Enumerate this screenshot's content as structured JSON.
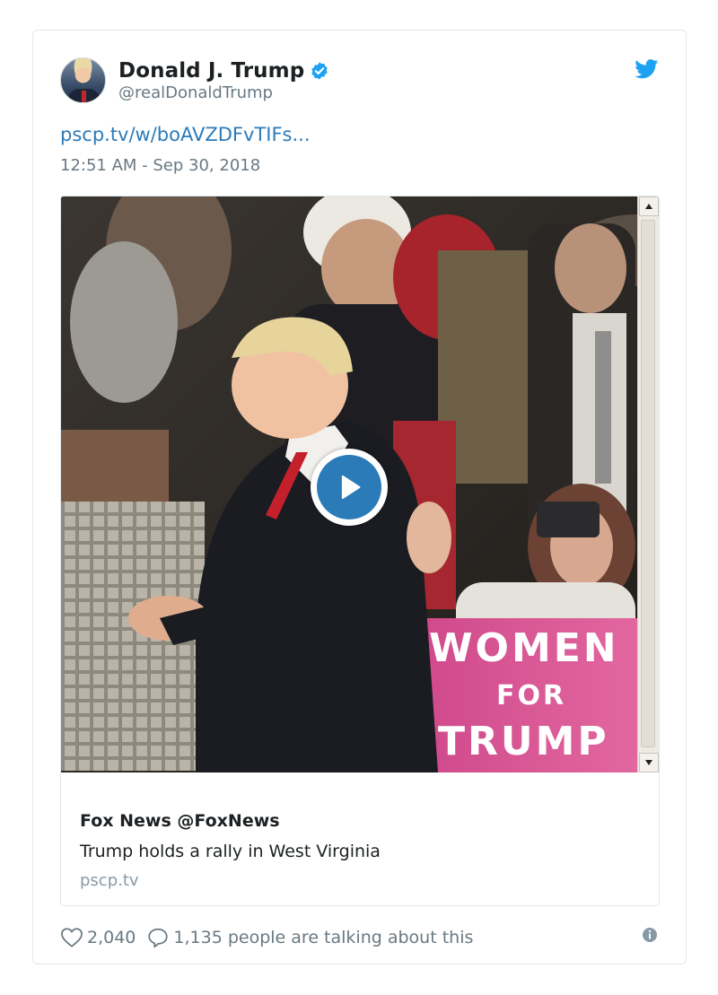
{
  "author": {
    "name": "Donald J. Trump",
    "handle": "@realDonaldTrump"
  },
  "tweet": {
    "link_text": "pscp.tv/w/boAVZDFvTIFs...",
    "timestamp": "12:51 AM - Sep 30, 2018"
  },
  "media": {
    "sign_text": [
      "WOMEN",
      "FOR",
      "TRUMP"
    ]
  },
  "card": {
    "source": "Fox News @FoxNews",
    "title": "Trump holds a rally in West Virginia",
    "domain": "pscp.tv"
  },
  "footer": {
    "likes": "2,040",
    "talking": "1,135 people are talking about this"
  },
  "colors": {
    "link": "#2b7bb9",
    "verified": "#1da1f2",
    "muted": "#697882"
  }
}
